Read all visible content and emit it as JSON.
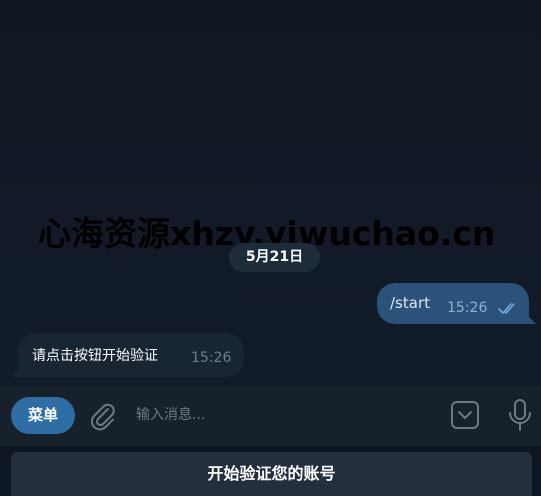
{
  "watermark": "心海资源xhzy.yiwuchao.cn",
  "date_divider": "5月21日",
  "messages": [
    {
      "direction": "out",
      "text": "/start",
      "time": "15:26",
      "status": "read"
    },
    {
      "direction": "in",
      "text": "请点击按钮开始验证",
      "time": "15:26"
    }
  ],
  "input_bar": {
    "menu_label": "菜单",
    "placeholder": "输入消息...",
    "icons": [
      "paperclip-icon",
      "keyboard-icon",
      "microphone-icon"
    ]
  },
  "reply_keyboard": {
    "button_label": "开始验证您的账号"
  },
  "colors": {
    "background": "#0e1621",
    "outgoing_bubble": "#2b5278",
    "incoming_bubble": "#182533",
    "menu_button": "#2f6ea5",
    "input_bar": "#17212b",
    "keyboard_button": "#232f3d"
  }
}
